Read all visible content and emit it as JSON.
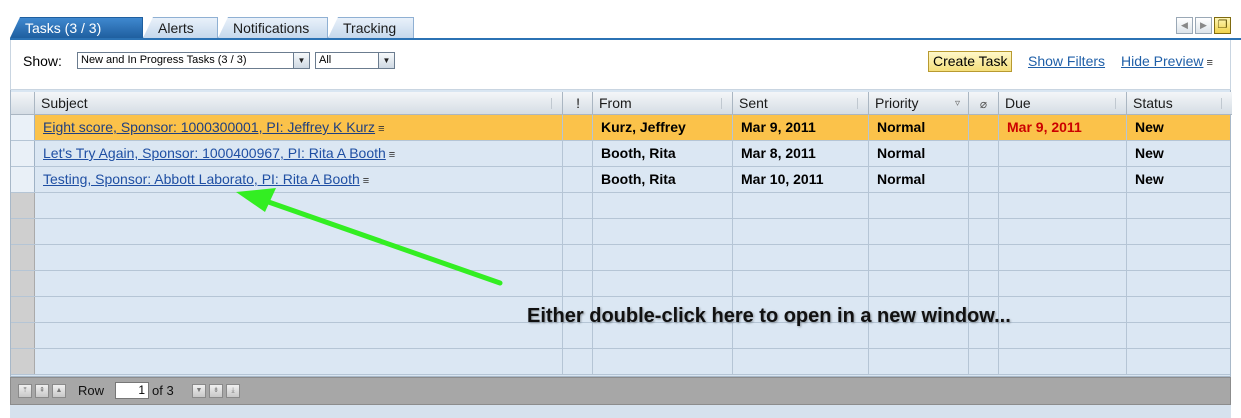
{
  "tabs": [
    {
      "label": "Tasks  (3 / 3)",
      "active": true
    },
    {
      "label": "Alerts",
      "active": false
    },
    {
      "label": "Notifications",
      "active": false
    },
    {
      "label": "Tracking",
      "active": false
    }
  ],
  "toolbar": {
    "show_label": "Show:",
    "filter_select": "New and In Progress Tasks  (3 / 3)",
    "scope_select": "All",
    "create_task": "Create Task",
    "show_filters": "Show Filters",
    "hide_preview": "Hide Preview"
  },
  "columns": {
    "subject": "Subject",
    "importance": "!",
    "from": "From",
    "sent": "Sent",
    "priority": "Priority",
    "attachment_icon": "paperclip-icon",
    "due": "Due",
    "status": "Status"
  },
  "rows": [
    {
      "subject": "Eight score, Sponsor: 1000300001, PI: Jeffrey K Kurz",
      "from": "Kurz, Jeffrey",
      "sent": "Mar 9, 2011",
      "priority": "Normal",
      "due": "Mar 9, 2011",
      "status": "New",
      "selected": true
    },
    {
      "subject": "Let's Try Again, Sponsor: 1000400967, PI: Rita A Booth",
      "from": "Booth, Rita",
      "sent": "Mar 8, 2011",
      "priority": "Normal",
      "due": "",
      "status": "New",
      "selected": false
    },
    {
      "subject": "Testing, Sponsor: Abbott Laborato, PI: Rita A Booth",
      "from": "Booth, Rita",
      "sent": "Mar 10, 2011",
      "priority": "Normal",
      "due": "",
      "status": "New",
      "selected": false
    }
  ],
  "footer": {
    "row_label": "Row",
    "row_value": "1",
    "of_label": "of 3"
  },
  "annotation": {
    "text": "Either double-click here to open in a new window..."
  },
  "colors": {
    "selected_row": "#fbc24a",
    "row_bg": "#dbe7f3",
    "link": "#1f4fa3",
    "due_highlight": "#cc0000",
    "annotation_arrow": "#33ee22",
    "tab_active": "#1f5f9f"
  }
}
